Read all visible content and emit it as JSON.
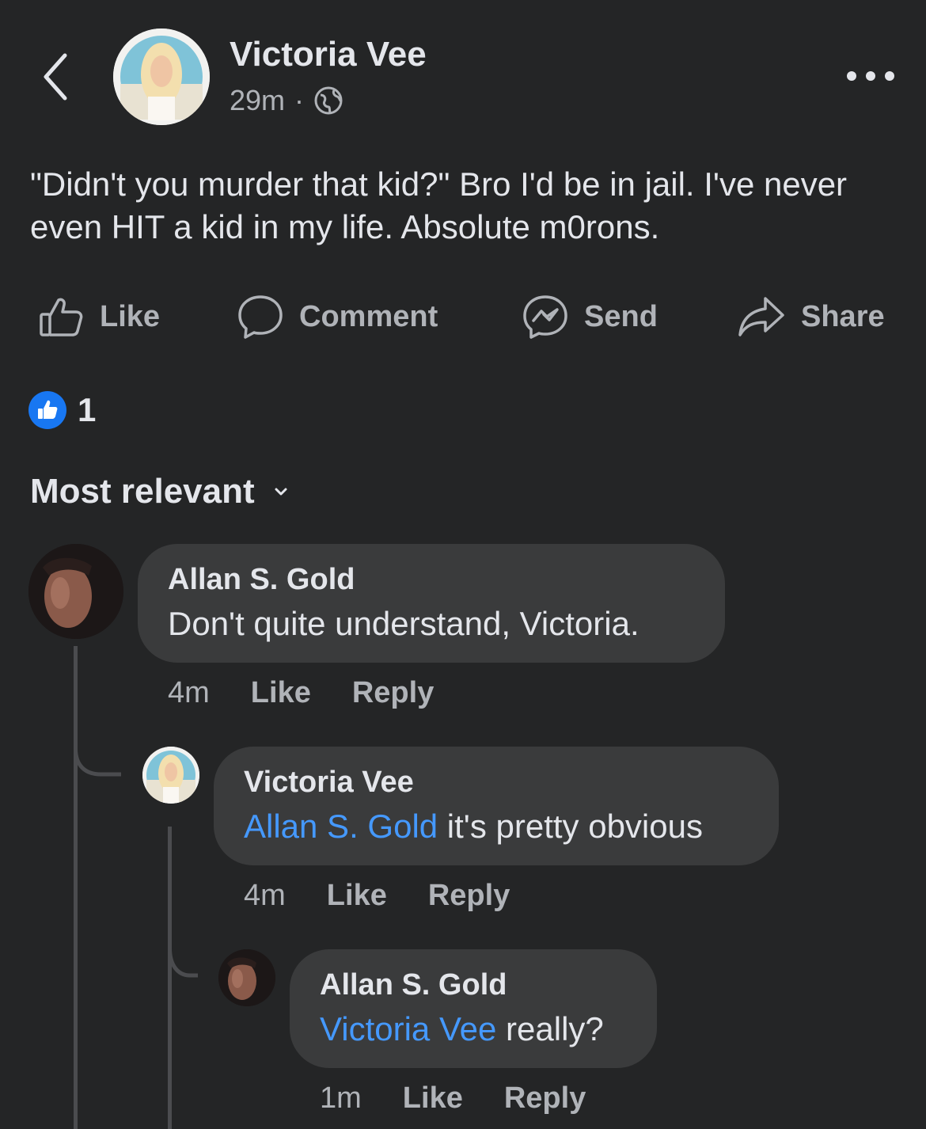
{
  "header": {
    "author": "Victoria Vee",
    "time": "29m",
    "separator": "·",
    "privacy_icon": "globe-icon"
  },
  "post": {
    "text": "\"Didn't you murder that kid?\" Bro I'd be in jail. I've never even HIT a kid in my life. Absolute m0rons."
  },
  "actions": {
    "like": "Like",
    "comment": "Comment",
    "send": "Send",
    "share": "Share"
  },
  "reactions": {
    "count": "1",
    "icon": "thumbs-up-icon"
  },
  "sort": {
    "label": "Most relevant"
  },
  "comments": [
    {
      "name": "Allan S. Gold",
      "mention": "",
      "text": "Don't quite understand, Victoria.",
      "time": "4m",
      "like": "Like",
      "reply": "Reply"
    },
    {
      "name": "Victoria Vee",
      "mention": "Allan S. Gold",
      "text": " it's pretty obvious",
      "time": "4m",
      "like": "Like",
      "reply": "Reply"
    },
    {
      "name": "Allan S. Gold",
      "mention": "Victoria Vee",
      "text": " really?",
      "time": "1m",
      "like": "Like",
      "reply": "Reply"
    }
  ],
  "colors": {
    "background": "#242526",
    "bubble": "#3a3b3c",
    "text": "#e4e6eb",
    "secondary": "#b0b3b8",
    "mention": "#4599ff",
    "like_blue": "#1877f2"
  }
}
